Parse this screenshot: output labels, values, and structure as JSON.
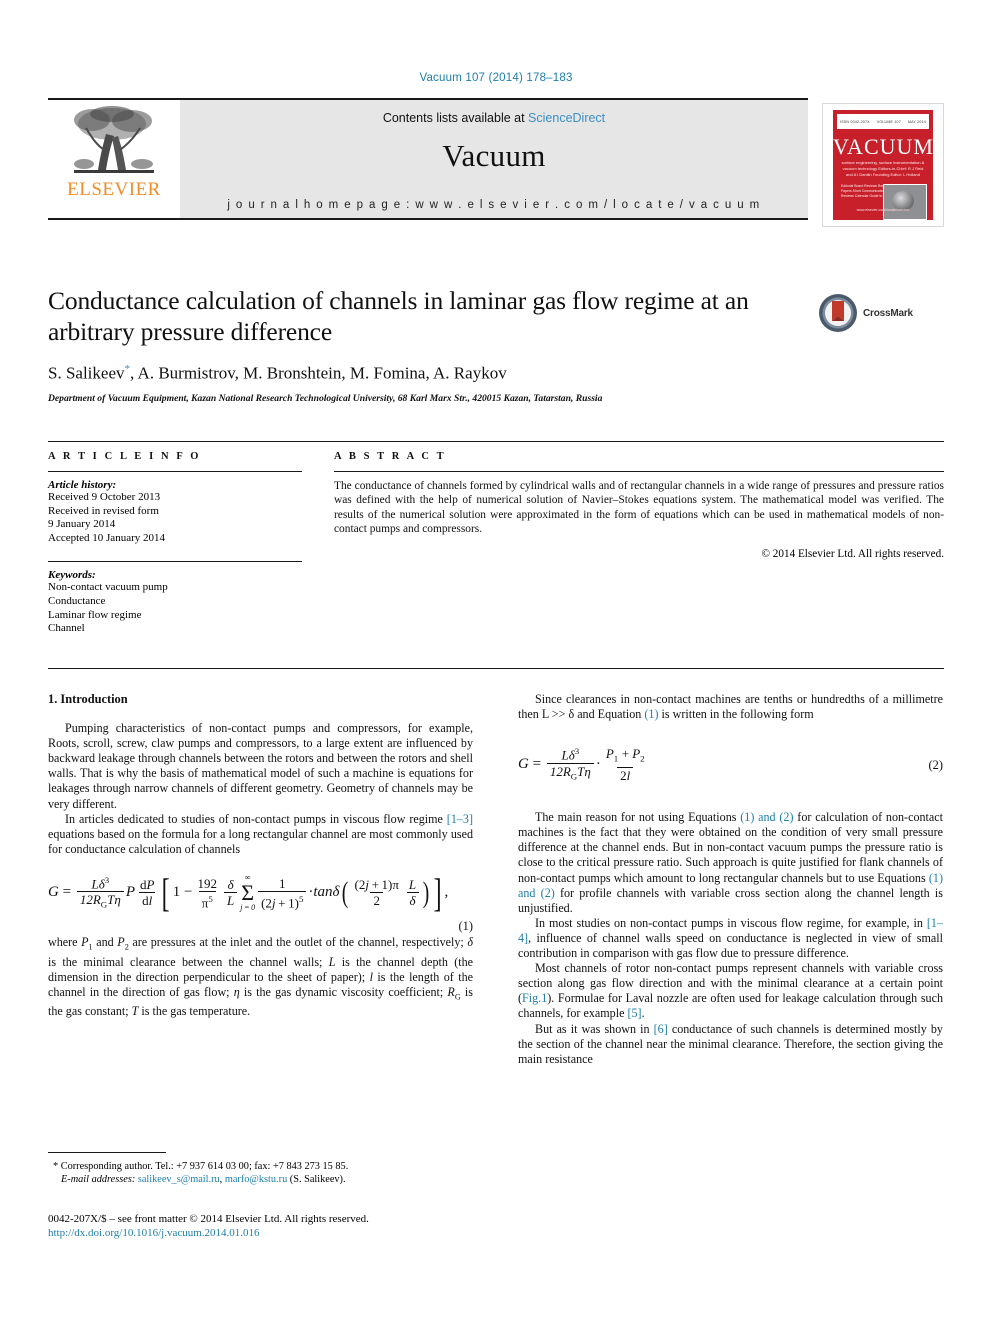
{
  "running_head": "Vacuum 107 (2014) 178–183",
  "masthead": {
    "contents_prefix": "Contents lists available at ",
    "sciencedirect": "ScienceDirect",
    "journal_name": "Vacuum",
    "homepage": "j o u r n a l   h o m e p a g e :   w w w . e l s e v i e r . c o m / l o c a t e / v a c u u m",
    "publisher": "ELSEVIER"
  },
  "cover": {
    "title": "VACUUM",
    "topbar_left": "ISSN 0042-207X",
    "topbar_mid": "VOLUME 107",
    "topbar_right": "MAY 2014",
    "subtitle": "surface engineering, surface instrumentation & vacuum technology\nEditors-in-Chief: R J Reid and A I Danilin\nFounding Editor: L Holland",
    "list": "Editorial Board\nReviews\nRegular Papers\nShort Communications\nBook Reviews\nCalendar\nGuide to Authors",
    "footer": "www.elsevier.com/locate/vacuum"
  },
  "crossmark": {
    "label": "CrossMark"
  },
  "article": {
    "title": "Conductance calculation of channels in laminar gas flow regime at an arbitrary pressure difference",
    "authors": "S. Salikeev",
    "authors_rest": ", A. Burmistrov, M. Bronshtein, M. Fomina, A. Raykov",
    "author_mark": "*",
    "affiliation": "Department of Vacuum Equipment, Kazan National Research Technological University, 68 Karl Marx Str., 420015 Kazan, Tatarstan, Russia"
  },
  "article_info": {
    "heading": "A R T I C L E   I N F O",
    "history_title": "Article history:",
    "history": [
      "Received 9 October 2013",
      "Received in revised form",
      "9 January 2014",
      "Accepted 10 January 2014"
    ],
    "keywords_title": "Keywords:",
    "keywords": [
      "Non-contact vacuum pump",
      "Conductance",
      "Laminar flow regime",
      "Channel"
    ]
  },
  "abstract": {
    "heading": "A B S T R A C T",
    "text": "The conductance of channels formed by cylindrical walls and of rectangular channels in a wide range of pressures and pressure ratios was defined with the help of numerical solution of Navier–Stokes equations system. The mathematical model was verified. The results of the numerical solution were approximated in the form of equations which can be used in mathematical models of non-contact pumps and compressors.",
    "copyright": "© 2014 Elsevier Ltd. All rights reserved."
  },
  "body": {
    "section1_heading": "1. Introduction",
    "left_p1_a": "Pumping characteristics of non-contact pumps and compressors, for example, Roots, scroll, screw, claw pumps and compressors, to a large extent are influenced by backward leakage through channels between the rotors and between the rotors and shell walls. That is why the basis of mathematical model of such a machine is equations for leakages through narrow channels of different geometry. Geometry of channels may be very different.",
    "left_p2_a": "In articles dedicated to studies of non-contact pumps in viscous flow regime ",
    "left_p2_ref": "[1–3]",
    "left_p2_b": " equations based on the formula for a long rectangular channel are most commonly used for conductance calculation of channels",
    "left_where": "where P1 and P2 are pressures at the inlet and the outlet of the channel, respectively; δ is the minimal clearance between the channel walls; L is the channel depth (the dimension in the direction perpendicular to the sheet of paper); l is the length of the channel in the direction of gas flow; η is the gas dynamic viscosity coefficient; RG is the gas constant; T is the gas temperature.",
    "right_p1_a": "Since clearances in non-contact machines are tenths or hundredths of a millimetre then L >> δ and Equation ",
    "right_p1_ref": "(1)",
    "right_p1_b": " is written in the following form",
    "right_p2_a": "The main reason for not using Equations ",
    "right_p2_ref": "(1) and (2)",
    "right_p2_b": " for calculation of non-contact machines is the fact that they were obtained on the condition of very small pressure difference at the channel ends. But in non-contact vacuum pumps the pressure ratio is close to the critical pressure ratio. Such approach is quite justified for flank channels of non-contact pumps which amount to long rectangular channels but to use Equations ",
    "right_p2_ref2": "(1) and (2)",
    "right_p2_c": " for profile channels with variable cross section along the channel length is unjustified.",
    "right_p3_a": "In most studies on non-contact pumps in viscous flow regime, for example, in ",
    "right_p3_ref": "[1–4]",
    "right_p3_b": ", influence of channel walls speed on conductance is neglected in view of small contribution in comparison with gas flow due to pressure difference.",
    "right_p4_a": "Most channels of rotor non-contact pumps represent channels with variable cross section along gas flow direction and with the minimal clearance at a certain point (",
    "right_p4_ref": "Fig.1",
    "right_p4_b": "). Formulae for Laval nozzle are often used for leakage calculation through such channels, for example ",
    "right_p4_ref2": "[5]",
    "right_p4_c": ".",
    "right_p5_a": "But as it was shown in ",
    "right_p5_ref": "[6]",
    "right_p5_b": " conductance of such channels is determined mostly by the section of the channel near the minimal clearance. Therefore, the section giving the main resistance"
  },
  "equations": {
    "eq1_number": "(1)",
    "eq2_number": "(2)",
    "eq1_latex": "G = Lδ³/(12 R_G T η) · P dP/dl [ 1 − (192/π⁵)(δ/L) Σ_{j=0}^{∞} 1/(2j+1)⁵ · tanδ( ((2j+1)π/2)(L/δ) ) ],",
    "eq2_latex": "G = Lδ³/(12 R_G T η) · (P₁ + P₂)/(2l)",
    "G": "G",
    "equals": "=",
    "L_delta3": "Lδ",
    "exp3": "3",
    "den1": "12R",
    "denG": "G",
    "denT": "Tη",
    "P": "P",
    "dP": "dP",
    "dl": "dl",
    "one": "1",
    "minus": "−",
    "c192": "192",
    "pi5num": "π",
    "pi5exp": "5",
    "delta": "δ",
    "Lsym": "L",
    "sum_lower": "j = 0",
    "sum_upper": "∞",
    "sigma": "Σ",
    "frac_one": "1",
    "den_2j1": "(2j + 1)",
    "den_exp5": "5",
    "tand": "· tanδ",
    "inner_num": "(2j + 1)π",
    "inner_den": "2",
    "inner_L": "L",
    "inner_d": "δ",
    "comma": ",",
    "P1P2": "P₁ + P₂",
    "den2l": "2l"
  },
  "footnote": {
    "line1": "* Corresponding author. Tel.: +7 937 614 03 00; fax: +7 843 273 15 85.",
    "line2_label": "E-mail addresses:",
    "email1": "salikeev_s@mail.ru",
    "email_sep": ", ",
    "email2": "marfo@kstu.ru",
    "line2_tail": " (S. Salikeev)."
  },
  "footer": {
    "issn_line": "0042-207X/$ – see front matter © 2014 Elsevier Ltd. All rights reserved.",
    "doi": "http://dx.doi.org/10.1016/j.vacuum.2014.01.016"
  }
}
